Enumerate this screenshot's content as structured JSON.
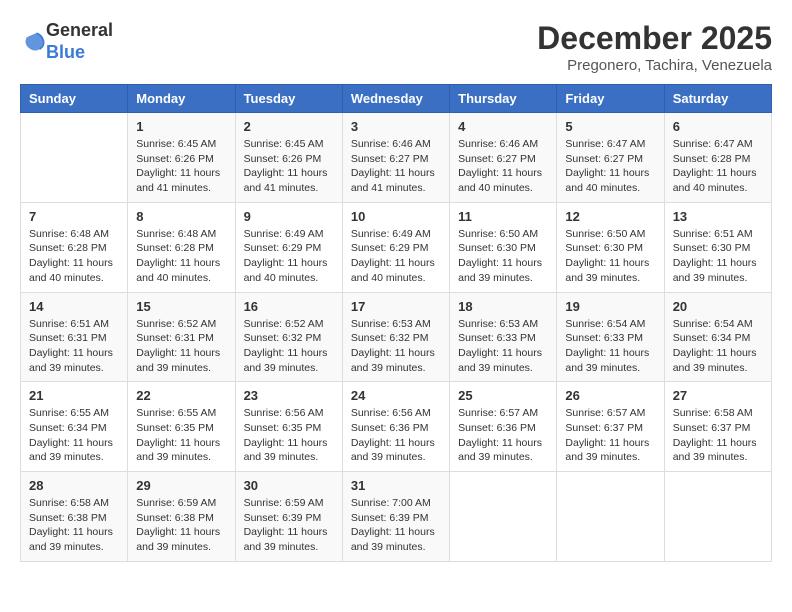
{
  "logo": {
    "general": "General",
    "blue": "Blue"
  },
  "title": "December 2025",
  "subtitle": "Pregonero, Tachira, Venezuela",
  "days_of_week": [
    "Sunday",
    "Monday",
    "Tuesday",
    "Wednesday",
    "Thursday",
    "Friday",
    "Saturday"
  ],
  "weeks": [
    [
      {
        "day": "",
        "sunrise": "",
        "sunset": "",
        "daylight": ""
      },
      {
        "day": "1",
        "sunrise": "Sunrise: 6:45 AM",
        "sunset": "Sunset: 6:26 PM",
        "daylight": "Daylight: 11 hours and 41 minutes."
      },
      {
        "day": "2",
        "sunrise": "Sunrise: 6:45 AM",
        "sunset": "Sunset: 6:26 PM",
        "daylight": "Daylight: 11 hours and 41 minutes."
      },
      {
        "day": "3",
        "sunrise": "Sunrise: 6:46 AM",
        "sunset": "Sunset: 6:27 PM",
        "daylight": "Daylight: 11 hours and 41 minutes."
      },
      {
        "day": "4",
        "sunrise": "Sunrise: 6:46 AM",
        "sunset": "Sunset: 6:27 PM",
        "daylight": "Daylight: 11 hours and 40 minutes."
      },
      {
        "day": "5",
        "sunrise": "Sunrise: 6:47 AM",
        "sunset": "Sunset: 6:27 PM",
        "daylight": "Daylight: 11 hours and 40 minutes."
      },
      {
        "day": "6",
        "sunrise": "Sunrise: 6:47 AM",
        "sunset": "Sunset: 6:28 PM",
        "daylight": "Daylight: 11 hours and 40 minutes."
      }
    ],
    [
      {
        "day": "7",
        "sunrise": "Sunrise: 6:48 AM",
        "sunset": "Sunset: 6:28 PM",
        "daylight": "Daylight: 11 hours and 40 minutes."
      },
      {
        "day": "8",
        "sunrise": "Sunrise: 6:48 AM",
        "sunset": "Sunset: 6:28 PM",
        "daylight": "Daylight: 11 hours and 40 minutes."
      },
      {
        "day": "9",
        "sunrise": "Sunrise: 6:49 AM",
        "sunset": "Sunset: 6:29 PM",
        "daylight": "Daylight: 11 hours and 40 minutes."
      },
      {
        "day": "10",
        "sunrise": "Sunrise: 6:49 AM",
        "sunset": "Sunset: 6:29 PM",
        "daylight": "Daylight: 11 hours and 40 minutes."
      },
      {
        "day": "11",
        "sunrise": "Sunrise: 6:50 AM",
        "sunset": "Sunset: 6:30 PM",
        "daylight": "Daylight: 11 hours and 39 minutes."
      },
      {
        "day": "12",
        "sunrise": "Sunrise: 6:50 AM",
        "sunset": "Sunset: 6:30 PM",
        "daylight": "Daylight: 11 hours and 39 minutes."
      },
      {
        "day": "13",
        "sunrise": "Sunrise: 6:51 AM",
        "sunset": "Sunset: 6:30 PM",
        "daylight": "Daylight: 11 hours and 39 minutes."
      }
    ],
    [
      {
        "day": "14",
        "sunrise": "Sunrise: 6:51 AM",
        "sunset": "Sunset: 6:31 PM",
        "daylight": "Daylight: 11 hours and 39 minutes."
      },
      {
        "day": "15",
        "sunrise": "Sunrise: 6:52 AM",
        "sunset": "Sunset: 6:31 PM",
        "daylight": "Daylight: 11 hours and 39 minutes."
      },
      {
        "day": "16",
        "sunrise": "Sunrise: 6:52 AM",
        "sunset": "Sunset: 6:32 PM",
        "daylight": "Daylight: 11 hours and 39 minutes."
      },
      {
        "day": "17",
        "sunrise": "Sunrise: 6:53 AM",
        "sunset": "Sunset: 6:32 PM",
        "daylight": "Daylight: 11 hours and 39 minutes."
      },
      {
        "day": "18",
        "sunrise": "Sunrise: 6:53 AM",
        "sunset": "Sunset: 6:33 PM",
        "daylight": "Daylight: 11 hours and 39 minutes."
      },
      {
        "day": "19",
        "sunrise": "Sunrise: 6:54 AM",
        "sunset": "Sunset: 6:33 PM",
        "daylight": "Daylight: 11 hours and 39 minutes."
      },
      {
        "day": "20",
        "sunrise": "Sunrise: 6:54 AM",
        "sunset": "Sunset: 6:34 PM",
        "daylight": "Daylight: 11 hours and 39 minutes."
      }
    ],
    [
      {
        "day": "21",
        "sunrise": "Sunrise: 6:55 AM",
        "sunset": "Sunset: 6:34 PM",
        "daylight": "Daylight: 11 hours and 39 minutes."
      },
      {
        "day": "22",
        "sunrise": "Sunrise: 6:55 AM",
        "sunset": "Sunset: 6:35 PM",
        "daylight": "Daylight: 11 hours and 39 minutes."
      },
      {
        "day": "23",
        "sunrise": "Sunrise: 6:56 AM",
        "sunset": "Sunset: 6:35 PM",
        "daylight": "Daylight: 11 hours and 39 minutes."
      },
      {
        "day": "24",
        "sunrise": "Sunrise: 6:56 AM",
        "sunset": "Sunset: 6:36 PM",
        "daylight": "Daylight: 11 hours and 39 minutes."
      },
      {
        "day": "25",
        "sunrise": "Sunrise: 6:57 AM",
        "sunset": "Sunset: 6:36 PM",
        "daylight": "Daylight: 11 hours and 39 minutes."
      },
      {
        "day": "26",
        "sunrise": "Sunrise: 6:57 AM",
        "sunset": "Sunset: 6:37 PM",
        "daylight": "Daylight: 11 hours and 39 minutes."
      },
      {
        "day": "27",
        "sunrise": "Sunrise: 6:58 AM",
        "sunset": "Sunset: 6:37 PM",
        "daylight": "Daylight: 11 hours and 39 minutes."
      }
    ],
    [
      {
        "day": "28",
        "sunrise": "Sunrise: 6:58 AM",
        "sunset": "Sunset: 6:38 PM",
        "daylight": "Daylight: 11 hours and 39 minutes."
      },
      {
        "day": "29",
        "sunrise": "Sunrise: 6:59 AM",
        "sunset": "Sunset: 6:38 PM",
        "daylight": "Daylight: 11 hours and 39 minutes."
      },
      {
        "day": "30",
        "sunrise": "Sunrise: 6:59 AM",
        "sunset": "Sunset: 6:39 PM",
        "daylight": "Daylight: 11 hours and 39 minutes."
      },
      {
        "day": "31",
        "sunrise": "Sunrise: 7:00 AM",
        "sunset": "Sunset: 6:39 PM",
        "daylight": "Daylight: 11 hours and 39 minutes."
      },
      {
        "day": "",
        "sunrise": "",
        "sunset": "",
        "daylight": ""
      },
      {
        "day": "",
        "sunrise": "",
        "sunset": "",
        "daylight": ""
      },
      {
        "day": "",
        "sunrise": "",
        "sunset": "",
        "daylight": ""
      }
    ]
  ]
}
